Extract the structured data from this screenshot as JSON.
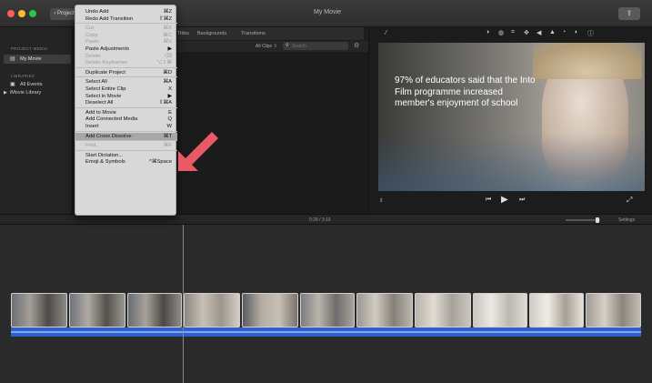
{
  "window": {
    "title": "My Movie",
    "projects_label": "‹ Projects",
    "share_label": "⇪"
  },
  "topbar": {
    "tabs": [
      "Titles",
      "Backgrounds",
      "Transitions"
    ],
    "filter_label": "All Clips ⇧",
    "search_placeholder": "Search"
  },
  "sidebar": {
    "project_media_heading": "PROJECT MEDIA",
    "project_item": "My Movie",
    "libraries_heading": "LIBRARIES",
    "all_events": "All Events",
    "library_item": "iMovie Library"
  },
  "menu": {
    "items": [
      {
        "label": "Undo Add",
        "shortcut": "⌘Z",
        "disabled": false
      },
      {
        "label": "Redo Add Transition",
        "shortcut": "⇧⌘Z",
        "disabled": false
      },
      {
        "sep": true
      },
      {
        "label": "Cut",
        "shortcut": "⌘X",
        "disabled": true
      },
      {
        "label": "Copy",
        "shortcut": "⌘C",
        "disabled": true
      },
      {
        "label": "Paste",
        "shortcut": "⌘V",
        "disabled": true
      },
      {
        "label": "Paste Adjustments",
        "shortcut": "▶",
        "disabled": false
      },
      {
        "label": "Delete",
        "shortcut": "⌫",
        "disabled": true
      },
      {
        "label": "Delete Keyframes",
        "shortcut": "⌥⇧⌘",
        "disabled": true
      },
      {
        "sep": true
      },
      {
        "label": "Duplicate Project",
        "shortcut": "⌘D",
        "disabled": false
      },
      {
        "sep": true
      },
      {
        "label": "Select All",
        "shortcut": "⌘A",
        "disabled": false
      },
      {
        "label": "Select Entire Clip",
        "shortcut": "X",
        "disabled": false
      },
      {
        "label": "Select in Movie",
        "shortcut": "▶",
        "disabled": false
      },
      {
        "label": "Deselect All",
        "shortcut": "⇧⌘A",
        "disabled": false
      },
      {
        "sep": true
      },
      {
        "label": "Add to Movie",
        "shortcut": "E",
        "disabled": false
      },
      {
        "label": "Add Connected Media",
        "shortcut": "Q",
        "disabled": false
      },
      {
        "label": "Insert",
        "shortcut": "W",
        "disabled": false
      },
      {
        "sep": true
      },
      {
        "label": "Add Cross Dissolve",
        "shortcut": "⌘T",
        "disabled": false,
        "highlighted": true
      },
      {
        "sep": true
      },
      {
        "label": "Find...",
        "shortcut": "⌘F",
        "disabled": true
      },
      {
        "sep": true
      },
      {
        "label": "Start Dictation...",
        "shortcut": "",
        "disabled": false
      },
      {
        "label": "Emoji & Symbols",
        "shortcut": "^⌘Space",
        "disabled": false
      }
    ]
  },
  "viewer": {
    "caption": "97% of educators said that the Into Film programme increased member's enjoyment of school"
  },
  "timeline": {
    "timecode": "0:28 / 3:16",
    "settings_label": "Settings"
  },
  "colors": {
    "accent": "#e85a64",
    "audio": "#2f5fc9",
    "menu_bg": "#d8d8d8"
  }
}
